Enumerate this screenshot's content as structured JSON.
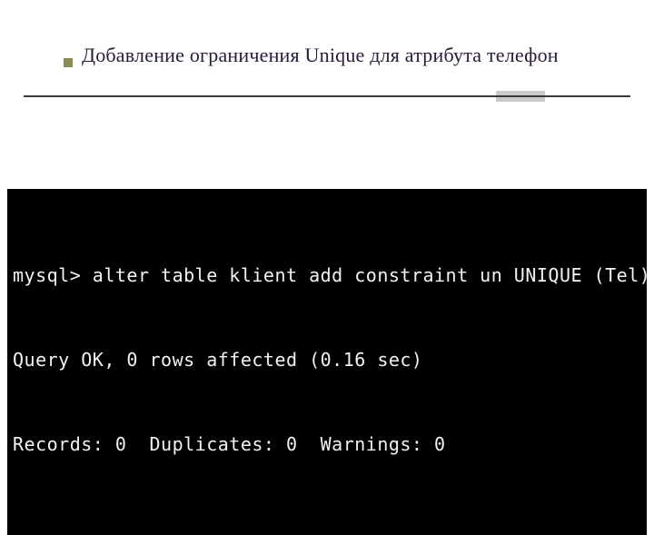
{
  "slide": {
    "title": "Добавление ограничения Unique для атрибута телефон"
  },
  "terminal": {
    "lines": [
      "mysql> alter table klient add constraint un UNIQUE (Tel);",
      "Query OK, 0 rows affected (0.16 sec)",
      "Records: 0  Duplicates: 0  Warnings: 0"
    ]
  }
}
